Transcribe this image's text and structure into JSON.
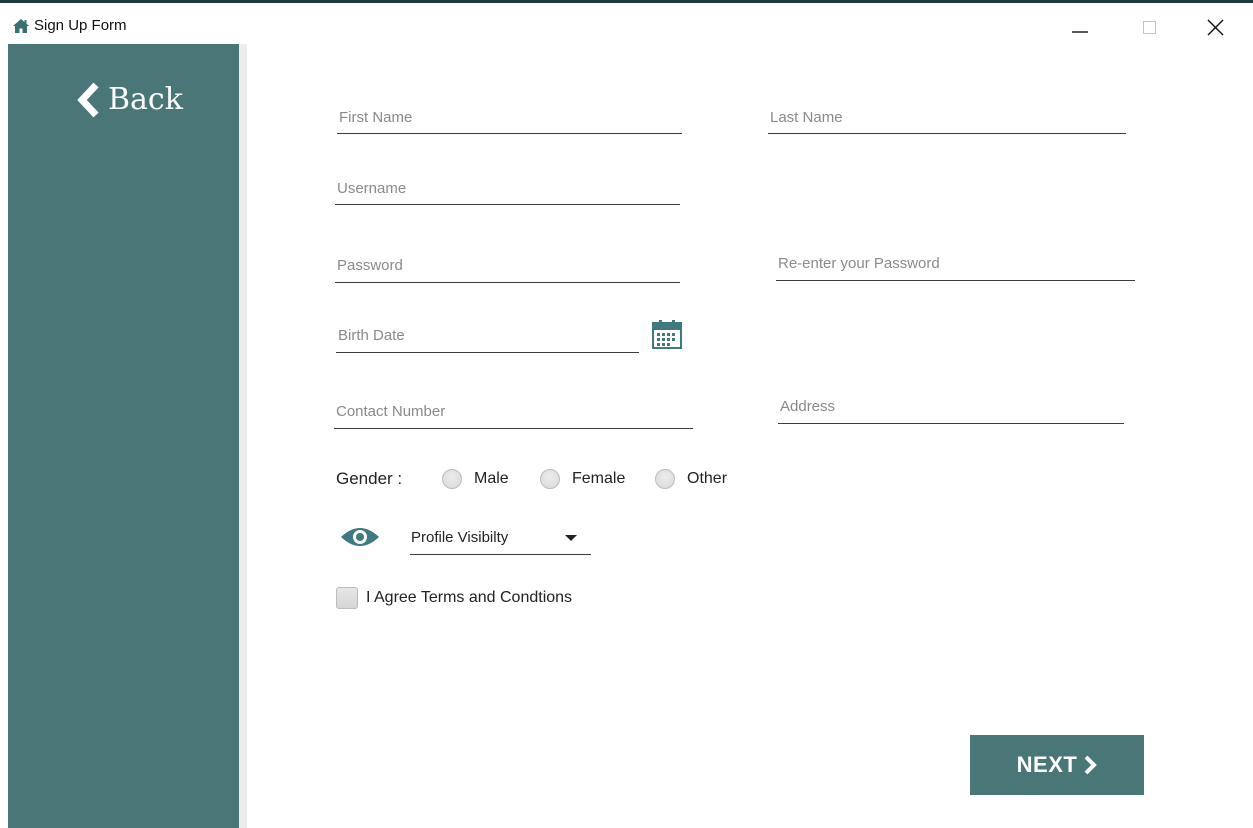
{
  "window": {
    "title": "Sign Up Form",
    "icon": "home-icon"
  },
  "sidebar": {
    "back_label": "Back",
    "color": "#497676"
  },
  "form": {
    "first_name": {
      "placeholder": "First Name",
      "value": ""
    },
    "last_name": {
      "placeholder": "Last Name",
      "value": ""
    },
    "username": {
      "placeholder": "Username",
      "value": ""
    },
    "password": {
      "placeholder": "Password",
      "value": ""
    },
    "password_confirm": {
      "placeholder": "Re-enter your Password",
      "value": ""
    },
    "birth_date": {
      "placeholder": "Birth Date",
      "value": ""
    },
    "contact_number": {
      "placeholder": "Contact Number",
      "value": ""
    },
    "address": {
      "placeholder": "Address",
      "value": ""
    },
    "gender": {
      "label": "Gender :",
      "options": [
        "Male",
        "Female",
        "Other"
      ]
    },
    "visibility": {
      "selected": "Profile Visibilty",
      "icon": "eye-icon"
    },
    "agree": {
      "label": "I Agree Terms and Condtions",
      "checked": false
    }
  },
  "actions": {
    "next_label": "NEXT"
  }
}
